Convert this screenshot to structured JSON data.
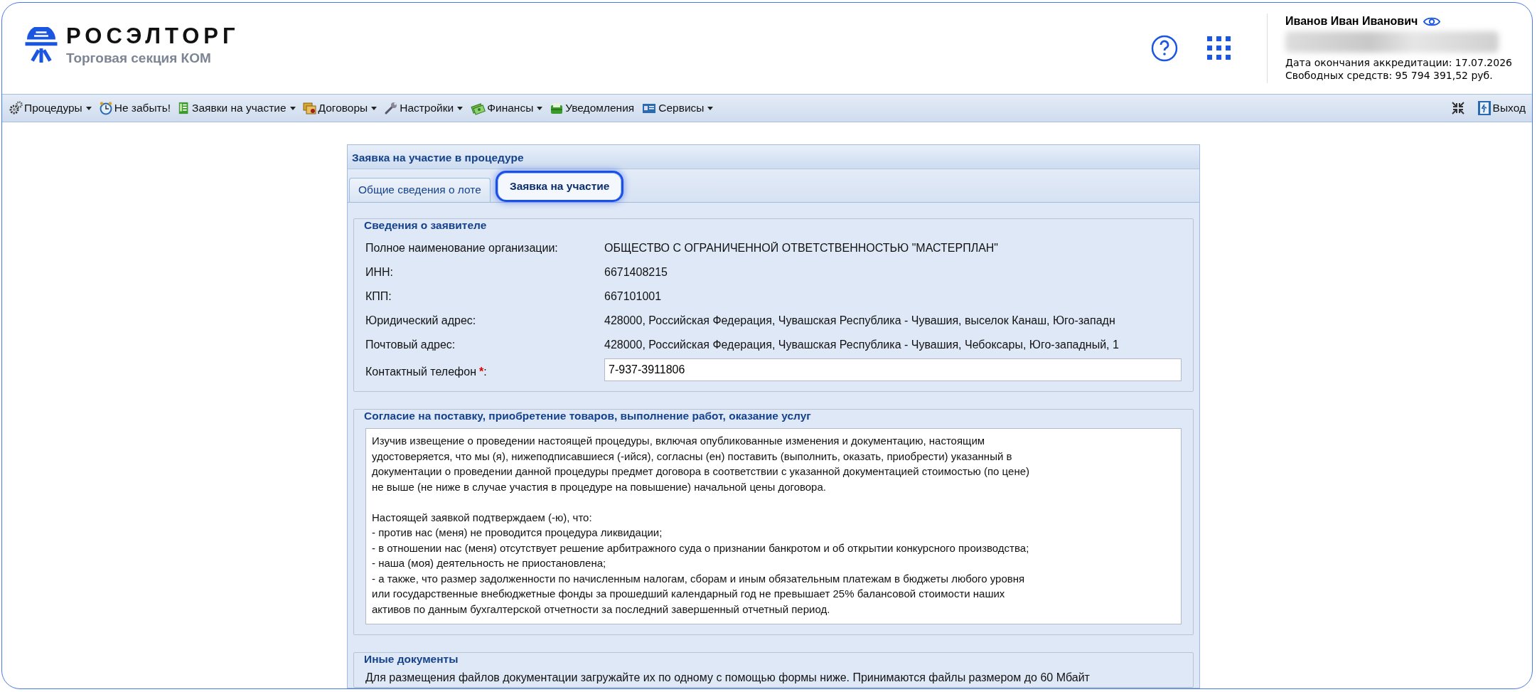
{
  "header": {
    "logo_title": "РОСЭЛТОРГ",
    "logo_subtitle": "Торговая секция КОМ",
    "user": {
      "name": "Иванов Иван Иванович",
      "accreditation": "Дата окончания аккредитации: 17.07.2026",
      "funds": "Свободных средств: 95 794 391,52 руб."
    }
  },
  "menu": [
    {
      "kind": "gears",
      "label": "Процедуры",
      "dropdown": true
    },
    {
      "kind": "clock",
      "label": "Не забыть!",
      "dropdown": false
    },
    {
      "kind": "sheet",
      "label": "Заявки на участие",
      "dropdown": true
    },
    {
      "kind": "folders",
      "label": "Договоры",
      "dropdown": true
    },
    {
      "kind": "wrench",
      "label": "Настройки",
      "dropdown": true
    },
    {
      "kind": "money",
      "label": "Финансы",
      "dropdown": true
    },
    {
      "kind": "tray",
      "label": "Уведомления",
      "dropdown": false
    },
    {
      "kind": "card",
      "label": "Сервисы",
      "dropdown": true
    }
  ],
  "exit": {
    "label": "Выход"
  },
  "panel": {
    "title": "Заявка на участие в процедуре",
    "tabs": [
      {
        "label": "Общие сведения о лоте",
        "selected": false
      },
      {
        "label": "Заявка на участие",
        "selected": true
      }
    ],
    "applicant": {
      "legend": "Сведения о заявителе",
      "rows": [
        {
          "kind": "text",
          "label": "Полное наименование организации:",
          "value": "ОБЩЕСТВО С ОГРАНИЧЕННОЙ ОТВЕТСТВЕННОСТЬЮ \"МАСТЕРПЛАН\""
        },
        {
          "kind": "text",
          "label": "ИНН:",
          "value": "6671408215"
        },
        {
          "kind": "text",
          "label": "КПП:",
          "value": "667101001"
        },
        {
          "kind": "text",
          "label": "Юридический адрес:",
          "value": "428000, Российская Федерация, Чувашская Республика - Чувашия, выселок Канаш, Юго-западн"
        },
        {
          "kind": "text",
          "label": "Почтовый адрес:",
          "value": "428000, Российская Федерация, Чувашская Республика - Чувашия, Чебоксары, Юго-западный, 1"
        },
        {
          "kind": "input",
          "label": "Контактный телефон",
          "required_mark": "*",
          "label_suffix": ":",
          "value": "7-937-3911806"
        }
      ]
    },
    "consent": {
      "legend": "Согласие на поставку, приобретение товаров, выполнение работ, оказание услуг",
      "text": "Изучив извещение о проведении настоящей процедуры, включая опубликованные изменения и документацию, настоящим\nудостоверяется, что мы (я), нижеподписавшиеся (-ийся), согласны (ен) поставить (выполнить, оказать, приобрести) указанный в\nдокументации о проведении данной процедуры предмет договора в соответствии с указанной документацией стоимостью (по цене)\nне выше (не ниже в случае участия в процедуре на повышение) начальной цены договора.\n\nНастоящей заявкой подтверждаем (-ю), что:\n- против нас (меня) не проводится процедура ликвидации;\n- в отношении нас (меня) отсутствует решение арбитражного суда о признании банкротом и об открытии конкурсного производства;\n- наша (моя) деятельность не приостановлена;\n- а также, что размер задолженности по начисленным налогам, сборам и иным обязательным платежам в бюджеты любого уровня\nили государственные внебюджетные фонды за прошедший календарный год не превышает 25% балансовой стоимости наших\nактивов по данным бухгалтерской отчетности за последний завершенный отчетный период."
    },
    "documents": {
      "legend": "Иные документы",
      "text": "Для размещения файлов документации загружайте их по одному с помощью формы ниже. Принимаются файлы размером до 60 Мбайт"
    }
  }
}
